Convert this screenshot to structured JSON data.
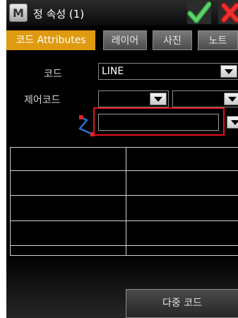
{
  "window": {
    "app_icon_letter": "M",
    "title": "정 속성 (1)",
    "ok_icon": "checkmark-icon",
    "cancel_icon": "close-icon",
    "ok_color": "#39b54a",
    "cancel_color": "#e21a1a"
  },
  "tabs": [
    {
      "label": "코드 Attributes",
      "active": true
    },
    {
      "label": "레이어",
      "active": false
    },
    {
      "label": "사진",
      "active": false
    },
    {
      "label": "노트",
      "active": false
    }
  ],
  "form": {
    "code_label": "코드",
    "code_value": "LINE",
    "control_code_label": "제어코드",
    "control_code_1_value": "",
    "control_code_2_value": "",
    "line_icon": "polyline-icon",
    "layer_value": ""
  },
  "grid": {
    "columns": 2,
    "rows": 5,
    "cells": []
  },
  "footer": {
    "multi_code_label": "다중 코드"
  },
  "colors": {
    "active_tab": "#e09a10",
    "highlight": "#e4121d"
  }
}
